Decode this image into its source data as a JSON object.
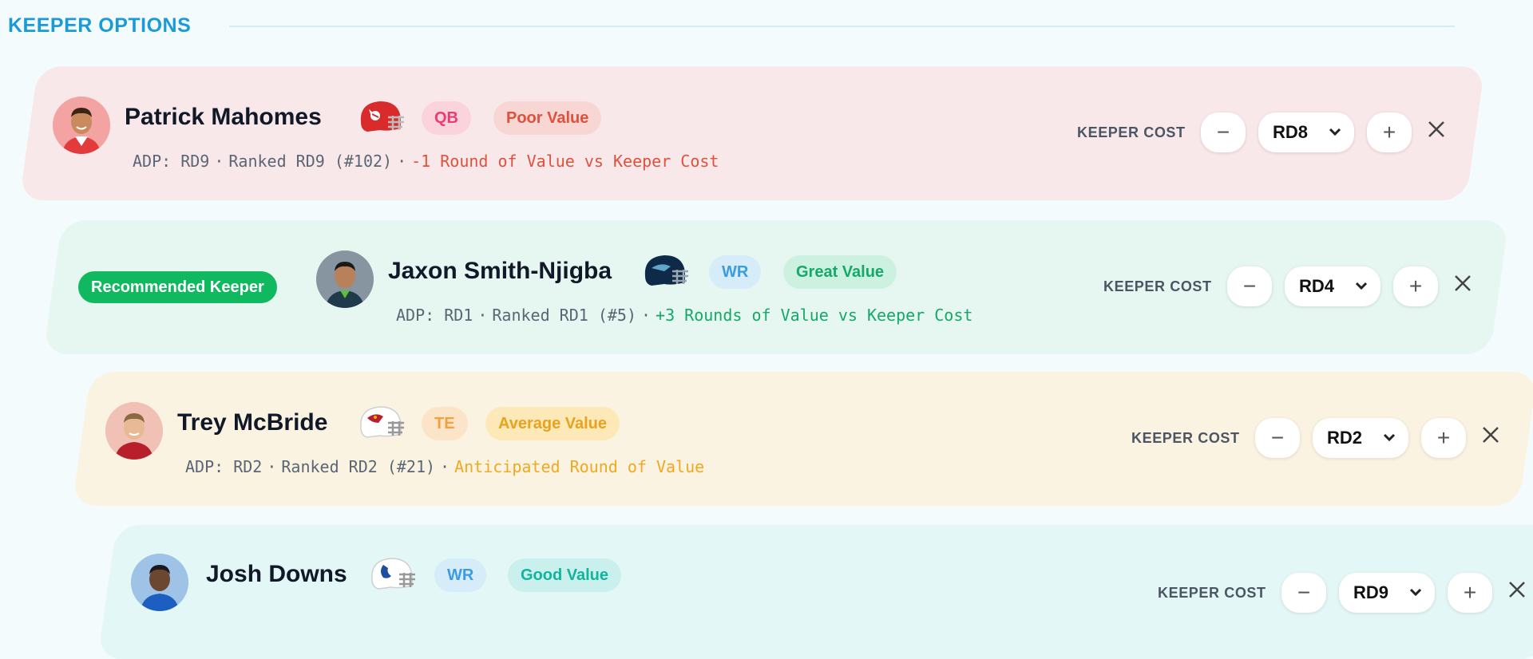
{
  "section": {
    "title": "KEEPER OPTIONS"
  },
  "keeper_cost_label": "KEEPER COST",
  "players": [
    {
      "name": "Patrick Mahomes",
      "position": "QB",
      "value_tag": "Poor Value",
      "adp": "ADP: RD9",
      "ranked": "Ranked RD9 (#102)",
      "value_note": "-1 Round of Value vs Keeper Cost",
      "keeper_round": "RD8",
      "team_helmet": "chiefs-helmet-icon",
      "colors": {
        "pos_bg": "#fbd3dd",
        "pos_fg": "#ea3d74",
        "tag_bg": "#f8d6d3",
        "tag_fg": "#e0513b",
        "note": "#e0513b"
      }
    },
    {
      "badge": "Recommended Keeper",
      "name": "Jaxon Smith-Njigba",
      "position": "WR",
      "value_tag": "Great Value",
      "adp": "ADP: RD1",
      "ranked": "Ranked RD1 (#5)",
      "value_note": "+3 Rounds of Value vs Keeper Cost",
      "keeper_round": "RD4",
      "team_helmet": "seahawks-helmet-icon",
      "colors": {
        "pos_bg": "#d6ecf8",
        "pos_fg": "#3b9ce0",
        "tag_bg": "#ccf1e0",
        "tag_fg": "#16a868",
        "note": "#16a868"
      }
    },
    {
      "name": "Trey McBride",
      "position": "TE",
      "value_tag": "Average Value",
      "adp": "ADP: RD2",
      "ranked": "Ranked RD2 (#21)",
      "value_note": "Anticipated Round of Value",
      "keeper_round": "RD2",
      "team_helmet": "cardinals-helmet-icon",
      "colors": {
        "pos_bg": "#fce4c9",
        "pos_fg": "#f59f3b",
        "tag_bg": "#fde9b8",
        "tag_fg": "#e8a21c",
        "note": "#f0a91f"
      }
    },
    {
      "name": "Josh Downs",
      "position": "WR",
      "value_tag": "Good Value",
      "keeper_round": "RD9",
      "team_helmet": "colts-helmet-icon",
      "colors": {
        "pos_bg": "#d6ecf8",
        "pos_fg": "#3b9ce0",
        "tag_bg": "#c9f0ec",
        "tag_fg": "#13b39e"
      }
    }
  ]
}
